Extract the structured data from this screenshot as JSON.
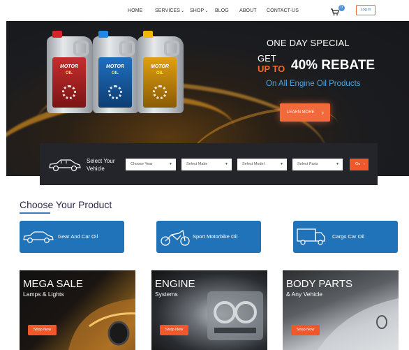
{
  "nav": {
    "items": [
      {
        "label": "HOME"
      },
      {
        "label": "SERVICES",
        "caret": "⌄"
      },
      {
        "label": "SHOP",
        "caret": "⌄"
      },
      {
        "label": "BLOG"
      },
      {
        "label": "ABOUT"
      },
      {
        "label": "CONTACT-US"
      }
    ],
    "cart_count": "0",
    "login_label": "Log in"
  },
  "hero": {
    "bottles": [
      {
        "brand": "MOTOR",
        "sub": "OIL",
        "cap_color": "#d8232a",
        "label_color": "#c62d2d"
      },
      {
        "brand": "MOTOR",
        "sub": "OIL",
        "cap_color": "#1e88e5",
        "label_color": "#1f6fc0"
      },
      {
        "brand": "MOTOR",
        "sub": "OIL",
        "cap_color": "#f2b705",
        "label_color": "#e0a010"
      }
    ],
    "title": "ONE DAY SPECIAL",
    "get": "GET",
    "upto": "UP TO",
    "rebate": "40% REBATE",
    "subtitle": "On All Engine Oil Products",
    "cta": "LEARN MORE",
    "cta_icon": "›"
  },
  "selector": {
    "label": "Select Your Vehicle",
    "dropdowns": [
      {
        "placeholder": "Choose Year"
      },
      {
        "placeholder": "Select Make"
      },
      {
        "placeholder": "Select Model"
      },
      {
        "placeholder": "Select Parts"
      }
    ],
    "go_label": "Go",
    "go_icon": "›"
  },
  "products": {
    "heading": "Choose Your Product",
    "items": [
      {
        "label": "Gear And Car Oil",
        "icon": "car-icon"
      },
      {
        "label": "Sport Motorbike Oil",
        "icon": "motorbike-icon"
      },
      {
        "label": "Cargo Car Oil",
        "icon": "truck-icon"
      }
    ]
  },
  "promos": [
    {
      "title": "MEGA SALE",
      "subtitle": "Lamps & Lights",
      "button": "Shop Now"
    },
    {
      "title": "ENGINE",
      "subtitle": "Systems",
      "button": "Shop Now"
    },
    {
      "title": "BODY PARTS",
      "subtitle": "& Any Vehicle",
      "button": "Shop Now"
    }
  ],
  "colors": {
    "accent": "#f0572b",
    "brand_blue": "#2073b8",
    "dark": "#23252b"
  }
}
